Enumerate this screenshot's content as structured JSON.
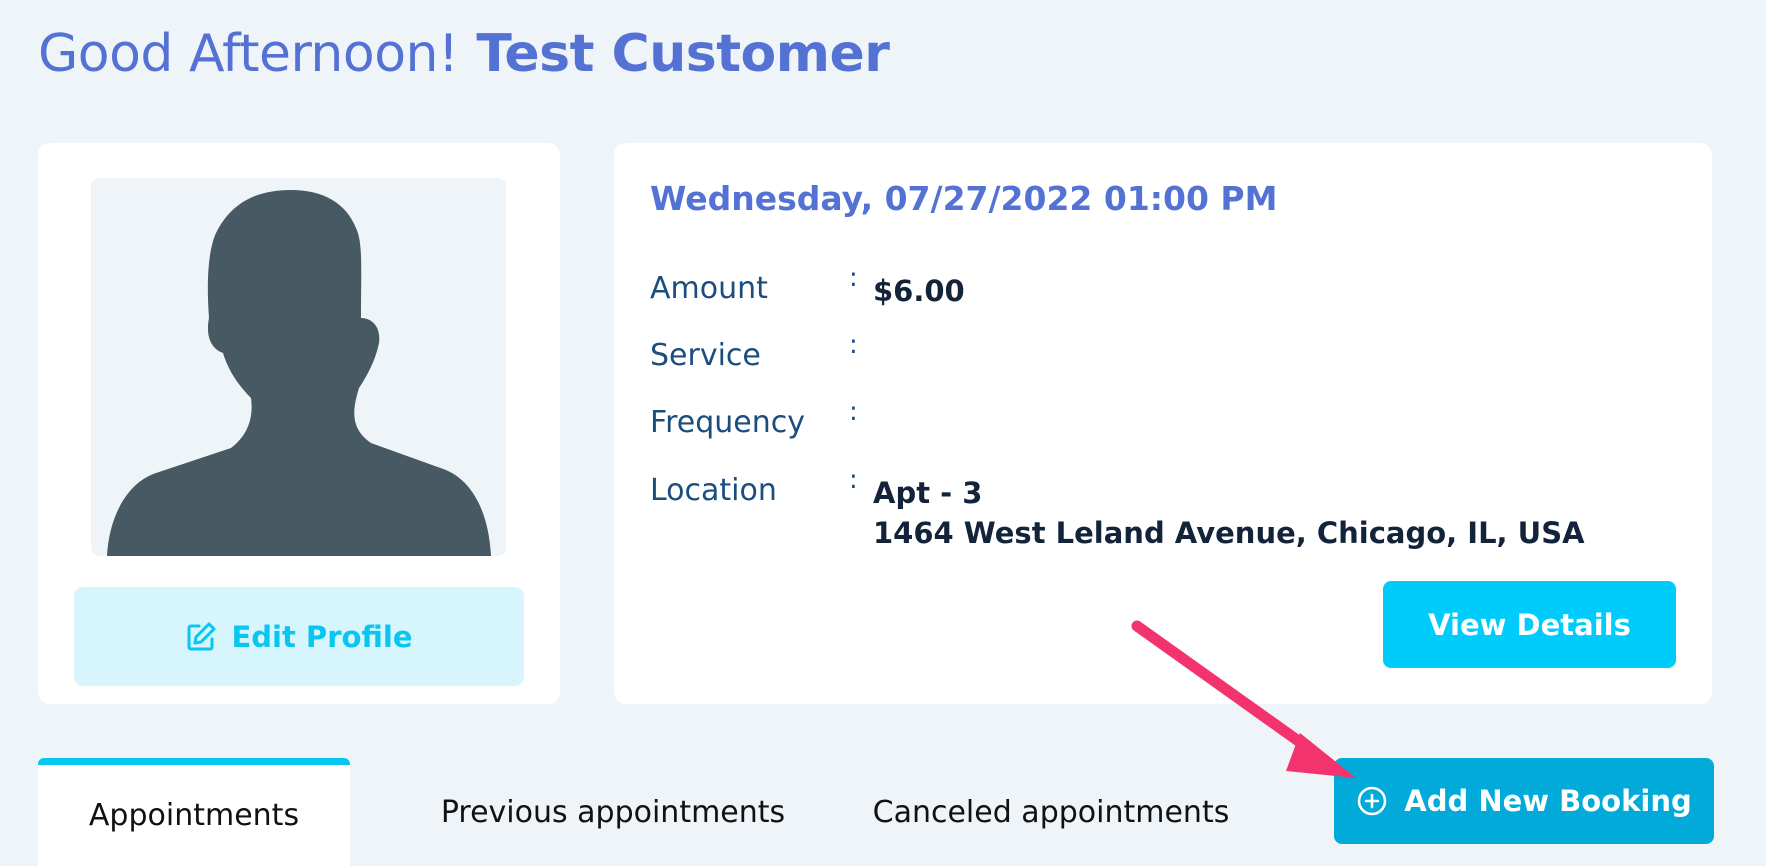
{
  "header": {
    "greeting": "Good Afternoon!",
    "customer_name": "Test Customer"
  },
  "profile": {
    "edit_label": "Edit Profile"
  },
  "appointment": {
    "datetime": "Wednesday, 07/27/2022 01:00 PM",
    "rows": [
      {
        "label": "Amount",
        "value": "$6.00"
      },
      {
        "label": "Service",
        "value": ""
      },
      {
        "label": "Frequency",
        "value": ""
      },
      {
        "label": "Location",
        "value_line1": "Apt - 3",
        "value_line2": "1464 West Leland Avenue, Chicago, IL, USA"
      }
    ],
    "separator": ":",
    "view_details_label": "View Details"
  },
  "tabs": [
    {
      "label": "Appointments",
      "active": true
    },
    {
      "label": "Previous appointments",
      "active": false
    },
    {
      "label": "Canceled appointments",
      "active": false
    }
  ],
  "add_booking_label": "Add New Booking",
  "icons": {
    "avatar": "person-silhouette-icon",
    "edit": "edit-icon",
    "add": "plus-circle-icon"
  },
  "colors": {
    "background": "#eff4f9",
    "brand_blue": "#5472d4",
    "accent_cyan": "#00ccfc",
    "booking_button": "#02aad9",
    "annotation_arrow": "#f2336d"
  }
}
